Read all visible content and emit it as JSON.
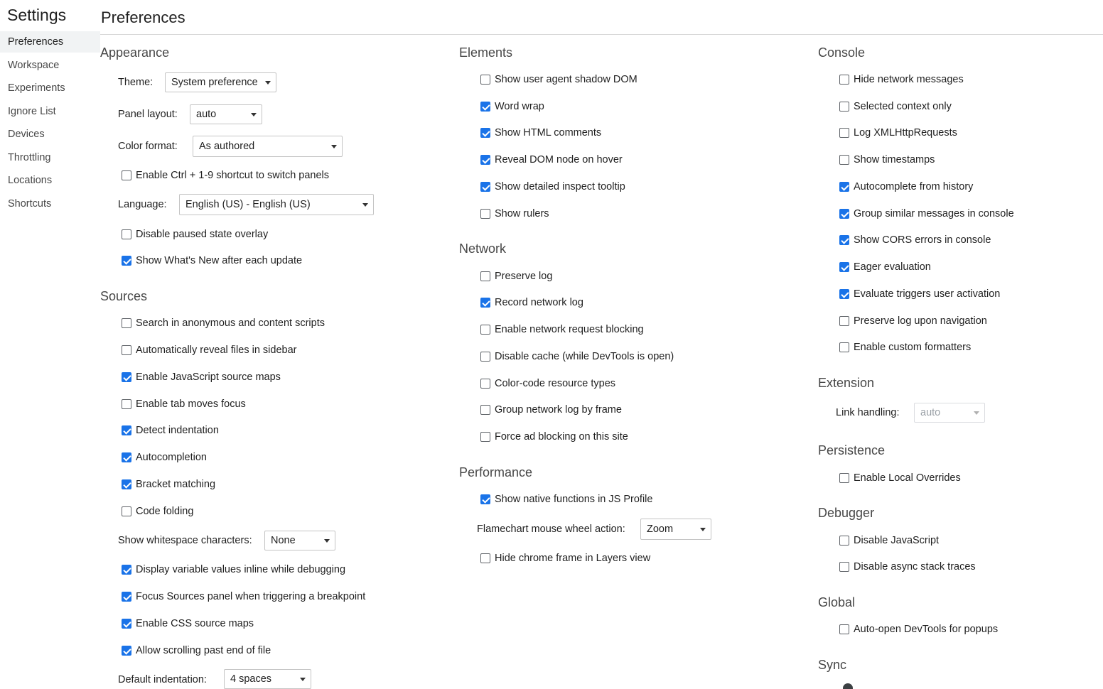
{
  "sidebar": {
    "title": "Settings",
    "items": [
      {
        "label": "Preferences",
        "selected": true
      },
      {
        "label": "Workspace"
      },
      {
        "label": "Experiments"
      },
      {
        "label": "Ignore List"
      },
      {
        "label": "Devices"
      },
      {
        "label": "Throttling"
      },
      {
        "label": "Locations"
      },
      {
        "label": "Shortcuts"
      }
    ]
  },
  "page_title": "Preferences",
  "appearance": {
    "title": "Appearance",
    "theme_label": "Theme:",
    "theme_value": "System preference",
    "panel_layout_label": "Panel layout:",
    "panel_layout_value": "auto",
    "color_format_label": "Color format:",
    "color_format_value": "As authored",
    "ctrl_shortcut": {
      "label": "Enable Ctrl + 1-9 shortcut to switch panels",
      "checked": false
    },
    "language_label": "Language:",
    "language_value": "English (US) - English (US)",
    "paused_overlay": {
      "label": "Disable paused state overlay",
      "checked": false
    },
    "whats_new": {
      "label": "Show What's New after each update",
      "checked": true
    }
  },
  "sources": {
    "title": "Sources",
    "options": [
      {
        "label": "Search in anonymous and content scripts",
        "checked": false
      },
      {
        "label": "Automatically reveal files in sidebar",
        "checked": false
      },
      {
        "label": "Enable JavaScript source maps",
        "checked": true
      },
      {
        "label": "Enable tab moves focus",
        "checked": false
      },
      {
        "label": "Detect indentation",
        "checked": true
      },
      {
        "label": "Autocompletion",
        "checked": true
      },
      {
        "label": "Bracket matching",
        "checked": true
      },
      {
        "label": "Code folding",
        "checked": false
      }
    ],
    "whitespace_label": "Show whitespace characters:",
    "whitespace_value": "None",
    "options2": [
      {
        "label": "Display variable values inline while debugging",
        "checked": true
      },
      {
        "label": "Focus Sources panel when triggering a breakpoint",
        "checked": true
      },
      {
        "label": "Enable CSS source maps",
        "checked": true
      },
      {
        "label": "Allow scrolling past end of file",
        "checked": true
      }
    ],
    "indentation_label": "Default indentation:",
    "indentation_value": "4 spaces"
  },
  "elements": {
    "title": "Elements",
    "options": [
      {
        "label": "Show user agent shadow DOM",
        "checked": false
      },
      {
        "label": "Word wrap",
        "checked": true
      },
      {
        "label": "Show HTML comments",
        "checked": true
      },
      {
        "label": "Reveal DOM node on hover",
        "checked": true
      },
      {
        "label": "Show detailed inspect tooltip",
        "checked": true
      },
      {
        "label": "Show rulers",
        "checked": false
      }
    ]
  },
  "network": {
    "title": "Network",
    "options": [
      {
        "label": "Preserve log",
        "checked": false
      },
      {
        "label": "Record network log",
        "checked": true
      },
      {
        "label": "Enable network request blocking",
        "checked": false
      },
      {
        "label": "Disable cache (while DevTools is open)",
        "checked": false
      },
      {
        "label": "Color-code resource types",
        "checked": false
      },
      {
        "label": "Group network log by frame",
        "checked": false
      },
      {
        "label": "Force ad blocking on this site",
        "checked": false
      }
    ]
  },
  "performance": {
    "title": "Performance",
    "native_functions": {
      "label": "Show native functions in JS Profile",
      "checked": true
    },
    "wheel_label": "Flamechart mouse wheel action:",
    "wheel_value": "Zoom",
    "hide_chrome_frame": {
      "label": "Hide chrome frame in Layers view",
      "checked": false
    }
  },
  "console": {
    "title": "Console",
    "options": [
      {
        "label": "Hide network messages",
        "checked": false
      },
      {
        "label": "Selected context only",
        "checked": false
      },
      {
        "label": "Log XMLHttpRequests",
        "checked": false
      },
      {
        "label": "Show timestamps",
        "checked": false
      },
      {
        "label": "Autocomplete from history",
        "checked": true
      },
      {
        "label": "Group similar messages in console",
        "checked": true
      },
      {
        "label": "Show CORS errors in console",
        "checked": true
      },
      {
        "label": "Eager evaluation",
        "checked": true
      },
      {
        "label": "Evaluate triggers user activation",
        "checked": true
      },
      {
        "label": "Preserve log upon navigation",
        "checked": false
      },
      {
        "label": "Enable custom formatters",
        "checked": false
      }
    ]
  },
  "extension": {
    "title": "Extension",
    "link_handling_label": "Link handling:",
    "link_handling_value": "auto"
  },
  "persistence": {
    "title": "Persistence",
    "local_overrides": {
      "label": "Enable Local Overrides",
      "checked": false
    }
  },
  "debugger": {
    "title": "Debugger",
    "options": [
      {
        "label": "Disable JavaScript",
        "checked": false
      },
      {
        "label": "Disable async stack traces",
        "checked": false
      }
    ]
  },
  "global": {
    "title": "Global",
    "auto_open": {
      "label": "Auto-open DevTools for popups",
      "checked": false
    }
  },
  "sync": {
    "title": "Sync"
  },
  "colors": {
    "accent": "#1a73e8"
  }
}
